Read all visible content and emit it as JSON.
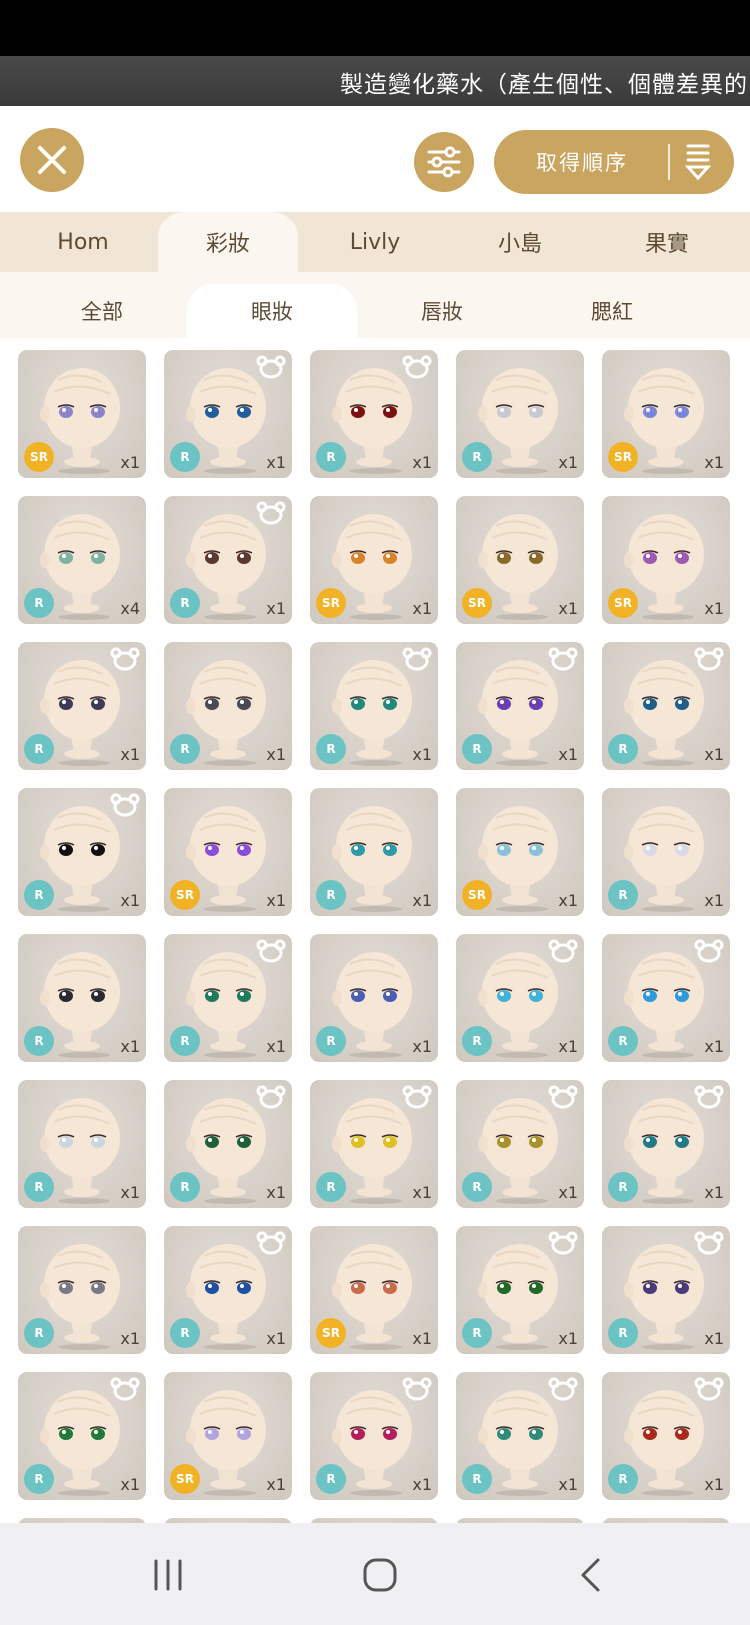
{
  "banner": {
    "text": "製造變化藥水（產生個性、個體差異的"
  },
  "toolbar": {
    "sort_label": "取得順序"
  },
  "category_tabs": [
    {
      "label": "Hom",
      "active": false
    },
    {
      "label": "彩妝",
      "active": true
    },
    {
      "label": "Livly",
      "active": false
    },
    {
      "label": "小島",
      "active": false
    },
    {
      "label": "果實",
      "active": false
    }
  ],
  "makeup_tabs": [
    {
      "label": "全部",
      "active": false
    },
    {
      "label": "眼妝",
      "active": true
    },
    {
      "label": "唇妝",
      "active": false
    },
    {
      "label": "腮紅",
      "active": false
    }
  ],
  "colors": {
    "accent": "#c9a55f",
    "rarity_r": "#6cc3c3",
    "rarity_sr": "#f1b325"
  },
  "items": [
    {
      "rarity": "SR",
      "qty": "x1",
      "bear": false,
      "eye": "#8a83c9"
    },
    {
      "rarity": "R",
      "qty": "x1",
      "bear": true,
      "eye": "#1f5f9c"
    },
    {
      "rarity": "R",
      "qty": "x1",
      "bear": true,
      "eye": "#7a1010"
    },
    {
      "rarity": "R",
      "qty": "x1",
      "bear": false,
      "eye": "#c9c9d6"
    },
    {
      "rarity": "SR",
      "qty": "x1",
      "bear": false,
      "eye": "#7a86d9"
    },
    {
      "rarity": "R",
      "qty": "x4",
      "bear": false,
      "eye": "#7fb3a3"
    },
    {
      "rarity": "R",
      "qty": "x1",
      "bear": true,
      "eye": "#5a3a2e"
    },
    {
      "rarity": "SR",
      "qty": "x1",
      "bear": false,
      "eye": "#d9842a"
    },
    {
      "rarity": "SR",
      "qty": "x1",
      "bear": false,
      "eye": "#8a6a2a"
    },
    {
      "rarity": "SR",
      "qty": "x1",
      "bear": false,
      "eye": "#9b5bb3"
    },
    {
      "rarity": "R",
      "qty": "x1",
      "bear": true,
      "eye": "#3f3a5a"
    },
    {
      "rarity": "R",
      "qty": "x1",
      "bear": false,
      "eye": "#4a4a55"
    },
    {
      "rarity": "R",
      "qty": "x1",
      "bear": true,
      "eye": "#1f8a7a"
    },
    {
      "rarity": "R",
      "qty": "x1",
      "bear": true,
      "eye": "#6a3fb3"
    },
    {
      "rarity": "R",
      "qty": "x1",
      "bear": true,
      "eye": "#1f5f8a"
    },
    {
      "rarity": "R",
      "qty": "x1",
      "bear": true,
      "eye": "#111111"
    },
    {
      "rarity": "SR",
      "qty": "x1",
      "bear": false,
      "eye": "#8a4fd9"
    },
    {
      "rarity": "R",
      "qty": "x1",
      "bear": false,
      "eye": "#2f9aa8"
    },
    {
      "rarity": "SR",
      "qty": "x1",
      "bear": false,
      "eye": "#8ac2d9"
    },
    {
      "rarity": "R",
      "qty": "x1",
      "bear": false,
      "eye": "#d9dbe8"
    },
    {
      "rarity": "R",
      "qty": "x1",
      "bear": false,
      "eye": "#2a2a30"
    },
    {
      "rarity": "R",
      "qty": "x1",
      "bear": true,
      "eye": "#1f7a5a"
    },
    {
      "rarity": "R",
      "qty": "x1",
      "bear": false,
      "eye": "#4a5fb3"
    },
    {
      "rarity": "R",
      "qty": "x1",
      "bear": true,
      "eye": "#3fb3d9"
    },
    {
      "rarity": "R",
      "qty": "x1",
      "bear": true,
      "eye": "#2f9ad9"
    },
    {
      "rarity": "R",
      "qty": "x1",
      "bear": false,
      "eye": "#c9d6e0"
    },
    {
      "rarity": "R",
      "qty": "x1",
      "bear": true,
      "eye": "#1f5f3a"
    },
    {
      "rarity": "R",
      "qty": "x1",
      "bear": true,
      "eye": "#e0c020"
    },
    {
      "rarity": "R",
      "qty": "x1",
      "bear": true,
      "eye": "#a8902a"
    },
    {
      "rarity": "R",
      "qty": "x1",
      "bear": true,
      "eye": "#1f7a8a"
    },
    {
      "rarity": "R",
      "qty": "x1",
      "bear": false,
      "eye": "#7a7a88"
    },
    {
      "rarity": "R",
      "qty": "x1",
      "bear": true,
      "eye": "#1f4fa8"
    },
    {
      "rarity": "SR",
      "qty": "x1",
      "bear": false,
      "eye": "#c96a4a"
    },
    {
      "rarity": "R",
      "qty": "x1",
      "bear": true,
      "eye": "#1f6a2a"
    },
    {
      "rarity": "R",
      "qty": "x1",
      "bear": true,
      "eye": "#4a3a7a"
    },
    {
      "rarity": "R",
      "qty": "x1",
      "bear": true,
      "eye": "#1f7a3a"
    },
    {
      "rarity": "SR",
      "qty": "x1",
      "bear": false,
      "eye": "#b3a3e0"
    },
    {
      "rarity": "R",
      "qty": "x1",
      "bear": true,
      "eye": "#b31f5a"
    },
    {
      "rarity": "R",
      "qty": "x1",
      "bear": true,
      "eye": "#2f8a7a"
    },
    {
      "rarity": "R",
      "qty": "x1",
      "bear": true,
      "eye": "#a82a1f"
    }
  ],
  "navbar": {
    "recents_icon": "recents-icon",
    "home_icon": "home-icon",
    "back_icon": "back-icon"
  }
}
